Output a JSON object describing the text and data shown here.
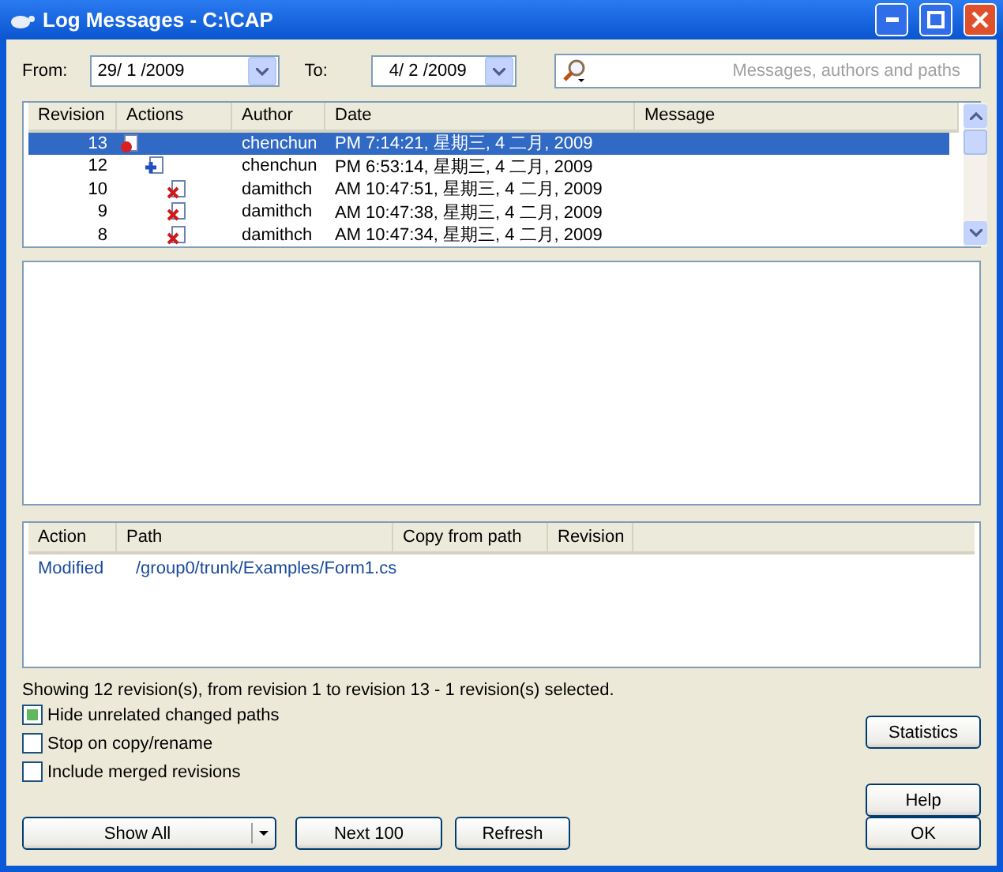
{
  "window": {
    "title": "Log Messages - C:\\CAP"
  },
  "filters": {
    "from_label": "From:",
    "from_value": "29/ 1 /2009",
    "to_label": "To:",
    "to_value": "4/ 2 /2009",
    "search_placeholder": "Messages, authors and paths"
  },
  "revisions": {
    "columns": [
      "Revision",
      "Actions",
      "Author",
      "Date",
      "Message"
    ],
    "rows": [
      {
        "revision": "13",
        "kind": "modified",
        "author": "chenchun",
        "date": "PM 7:14:21, 星期三, 4 二月, 2009",
        "selected": true
      },
      {
        "revision": "12",
        "kind": "added",
        "author": "chenchun",
        "date": "PM 6:53:14, 星期三, 4 二月, 2009",
        "selected": false
      },
      {
        "revision": "10",
        "kind": "deleted",
        "author": "damithch",
        "date": "AM 10:47:51, 星期三, 4 二月, 2009",
        "selected": false
      },
      {
        "revision": "9",
        "kind": "deleted",
        "author": "damithch",
        "date": "AM 10:47:38, 星期三, 4 二月, 2009",
        "selected": false
      },
      {
        "revision": "8",
        "kind": "deleted",
        "author": "damithch",
        "date": "AM 10:47:34, 星期三, 4 二月, 2009",
        "selected": false
      }
    ]
  },
  "paths": {
    "columns": [
      "Action",
      "Path",
      "Copy from path",
      "Revision"
    ],
    "rows": [
      {
        "action": "Modified",
        "path": "/group0/trunk/Examples/Form1.cs"
      }
    ]
  },
  "status": "Showing 12 revision(s), from revision 1 to revision 13 - 1 revision(s) selected.",
  "options": [
    {
      "label": "Hide unrelated changed paths",
      "checked": true
    },
    {
      "label": "Stop on copy/rename",
      "checked": false
    },
    {
      "label": "Include merged revisions",
      "checked": false
    }
  ],
  "buttons": {
    "show_all": "Show All",
    "next": "Next 100",
    "refresh": "Refresh",
    "statistics": "Statistics",
    "help": "Help",
    "ok": "OK"
  }
}
